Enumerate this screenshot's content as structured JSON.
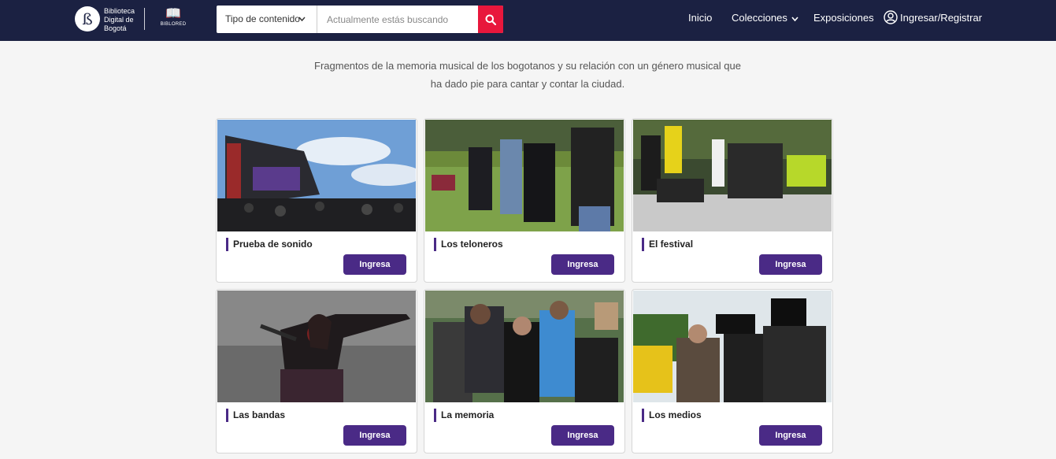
{
  "header": {
    "logo_text": "Biblioteca Digital de Bogotá",
    "partner_name": "BIBLORED",
    "search": {
      "type_label": "Tipo de contenido",
      "placeholder": "Actualmente estás buscando",
      "value": ""
    },
    "nav": {
      "inicio": "Inicio",
      "colecciones": "Colecciones",
      "exposiciones": "Exposiciones",
      "login": "Ingresar/Registrar"
    }
  },
  "intro": {
    "line1": "Fragmentos de la memoria musical de los bogotanos y su relación con un género musical que",
    "line2": "ha dado pie para cantar y contar la ciudad."
  },
  "cards": [
    {
      "title": "Prueba de sonido",
      "button": "Ingresa"
    },
    {
      "title": "Los teloneros",
      "button": "Ingresa"
    },
    {
      "title": "El festival",
      "button": "Ingresa"
    },
    {
      "title": "Las bandas",
      "button": "Ingresa"
    },
    {
      "title": "La memoria",
      "button": "Ingresa"
    },
    {
      "title": "Los medios",
      "button": "Ingresa"
    }
  ],
  "colors": {
    "header_bg": "#1b2142",
    "search_button": "#e8173c",
    "accent_purple": "#4a2a86",
    "page_bg": "#f5f5f5"
  }
}
